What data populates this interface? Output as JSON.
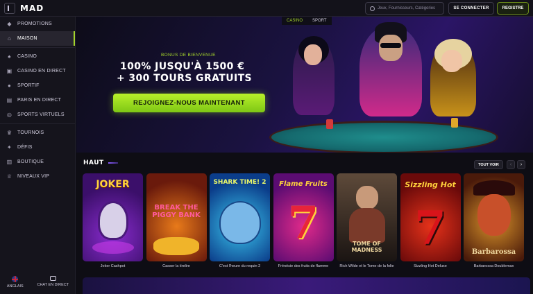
{
  "header": {
    "logo": "MAD",
    "search_placeholder": "Jeux, Fournisseurs, Catégories",
    "login_label": "SE CONNECTER",
    "register_label": "REGISTRE"
  },
  "sidebar": {
    "items": [
      {
        "label": "PROMOTIONS",
        "icon": "gift-icon",
        "glyph": "◆"
      },
      {
        "label": "MAISON",
        "icon": "home-icon",
        "glyph": "⌂",
        "active": true
      },
      {
        "label": "CASINO",
        "icon": "cards-icon",
        "glyph": "♠"
      },
      {
        "label": "CASINO EN DIRECT",
        "icon": "live-casino-icon",
        "glyph": "▣"
      },
      {
        "label": "SPORTIF",
        "icon": "ball-icon",
        "glyph": "●"
      },
      {
        "label": "PARIS EN DIRECT",
        "icon": "live-bet-icon",
        "glyph": "▤"
      },
      {
        "label": "SPORTS VIRTUELS",
        "icon": "virtual-sports-icon",
        "glyph": "◎"
      },
      {
        "label": "TOURNOIS",
        "icon": "trophy-icon",
        "glyph": "♛"
      },
      {
        "label": "DÉFIS",
        "icon": "challenge-icon",
        "glyph": "✦"
      },
      {
        "label": "BOUTIQUE",
        "icon": "shop-icon",
        "glyph": "▥"
      },
      {
        "label": "NIVEAUX VIP",
        "icon": "crown-icon",
        "glyph": "♕"
      }
    ],
    "language_label": "ANGLAIS",
    "chat_label": "CHAT EN DIRECT"
  },
  "hero": {
    "tabs": [
      "CASINO",
      "SPORT"
    ],
    "bonus_small": "BONUS DE BIENVENUE",
    "line1": "100% JUSQU'À 1500 €",
    "line2": "+ 300 TOURS GRATUITS",
    "cta": "REJOIGNEZ-NOUS MAINTENANT"
  },
  "top_section": {
    "title": "HAUT",
    "see_all": "TOUT VOIR",
    "prev": "‹",
    "next": "›",
    "games": [
      {
        "title": "Joker Cashpot",
        "art": "JOKER"
      },
      {
        "title": "Casser la tirelire",
        "art": "BREAK THE PIGGY BANK"
      },
      {
        "title": "C'est l'heure du requin 2",
        "art": "SHARK TIME! 2"
      },
      {
        "title": "Frénésie des fruits de flamme",
        "art": "Flame Fruits"
      },
      {
        "title": "Rich Wilde et le Tome de la folie",
        "art": "TOME OF MADNESS"
      },
      {
        "title": "Sizzling Hot Deluxe",
        "art": "Sizzling Hot"
      },
      {
        "title": "Barbarossa Doublemax",
        "art": "Barbarossa"
      }
    ]
  },
  "colors": {
    "accent": "#a4d42c",
    "background": "#0e0d14",
    "sidebar": "#15141c"
  }
}
